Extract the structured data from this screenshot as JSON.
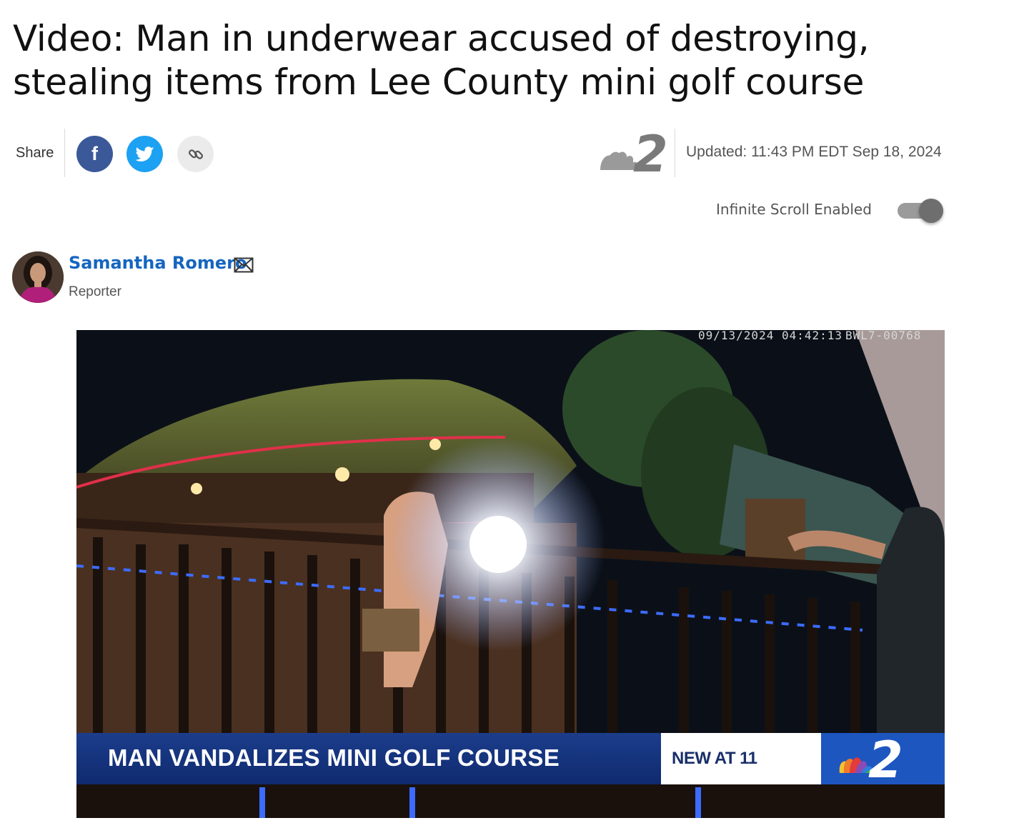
{
  "article": {
    "headline": "Video: Man in underwear accused of destroying, stealing items from Lee County mini golf course"
  },
  "share": {
    "label": "Share",
    "facebook_glyph": "f",
    "icons": [
      "facebook-icon",
      "twitter-icon",
      "link-icon"
    ]
  },
  "meta": {
    "updated": "Updated: 11:43 PM EDT Sep 18, 2024",
    "station_logo": "nbc2-logo"
  },
  "infinite_scroll": {
    "label": "Infinite Scroll Enabled",
    "enabled": true
  },
  "author": {
    "name": "Samantha Romero",
    "role": "Reporter"
  },
  "video": {
    "timestamp": "09/13/2024 04:42:13",
    "camera_id": "BWL7-00768",
    "chyron": {
      "headline": "MAN VANDALIZES MINI GOLF COURSE",
      "tag": "NEW AT 11"
    }
  },
  "colors": {
    "facebook": "#3b5998",
    "twitter": "#1da1f2",
    "author_link": "#1565c0",
    "chyron_blue": "#1c3d8c"
  }
}
